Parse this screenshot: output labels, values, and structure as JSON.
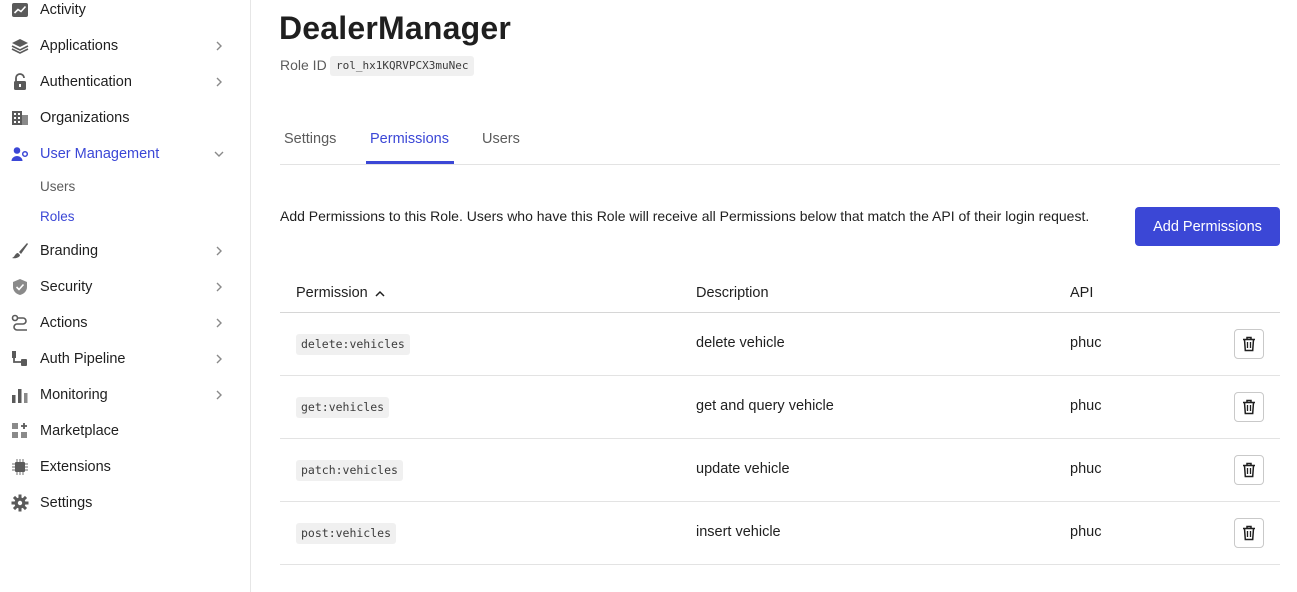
{
  "sidebar": {
    "items": [
      {
        "label": "Activity",
        "icon": "activity-icon"
      },
      {
        "label": "Applications",
        "icon": "layers-icon"
      },
      {
        "label": "Authentication",
        "icon": "lock-icon"
      },
      {
        "label": "Organizations",
        "icon": "building-icon"
      },
      {
        "label": "User Management",
        "icon": "users-icon"
      },
      {
        "label": "Branding",
        "icon": "brush-icon"
      },
      {
        "label": "Security",
        "icon": "shield-icon"
      },
      {
        "label": "Actions",
        "icon": "actions-flow-icon"
      },
      {
        "label": "Auth Pipeline",
        "icon": "pipeline-icon"
      },
      {
        "label": "Monitoring",
        "icon": "bar-chart-icon"
      },
      {
        "label": "Marketplace",
        "icon": "marketplace-icon"
      },
      {
        "label": "Extensions",
        "icon": "chip-icon"
      },
      {
        "label": "Settings",
        "icon": "gear-icon"
      }
    ],
    "user_management_sub": [
      {
        "label": "Users"
      },
      {
        "label": "Roles"
      }
    ]
  },
  "header": {
    "title": "DealerManager",
    "role_id_label": "Role ID",
    "role_id_value": "rol_hx1KQRVPCX3muNec"
  },
  "tabs": [
    {
      "label": "Settings"
    },
    {
      "label": "Permissions"
    },
    {
      "label": "Users"
    }
  ],
  "permissions": {
    "intro": "Add Permissions to this Role. Users who have this Role will receive all Permissions below that match the API of their login request.",
    "add_button": "Add Permissions",
    "columns": {
      "permission": "Permission",
      "description": "Description",
      "api": "API"
    },
    "rows": [
      {
        "permission": "delete:vehicles",
        "description": "delete vehicle",
        "api": "phuc"
      },
      {
        "permission": "get:vehicles",
        "description": "get and query vehicle",
        "api": "phuc"
      },
      {
        "permission": "patch:vehicles",
        "description": "update vehicle",
        "api": "phuc"
      },
      {
        "permission": "post:vehicles",
        "description": "insert vehicle",
        "api": "phuc"
      }
    ]
  },
  "colors": {
    "accent": "#3b47d6",
    "text": "#1f1f1f",
    "muted": "#5c5c5c",
    "code_bg": "#f0f0f0"
  }
}
